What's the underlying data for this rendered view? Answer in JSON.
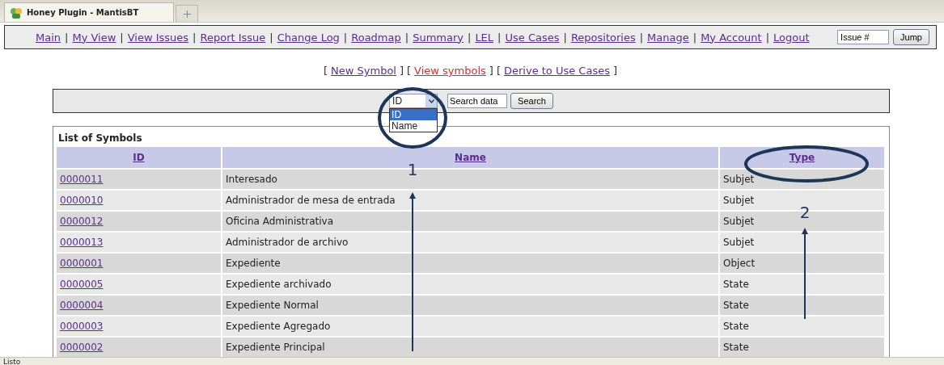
{
  "browser": {
    "tab_title": "Honey Plugin - MantisBT",
    "status": "Listo"
  },
  "nav": {
    "separator": "|",
    "links": [
      "Main",
      "My View",
      "View Issues",
      "Report Issue",
      "Change Log",
      "Roadmap",
      "Summary",
      "LEL",
      "Use Cases",
      "Repositories",
      "Manage",
      "My Account",
      "Logout"
    ],
    "issue_field": {
      "value": "Issue #"
    },
    "jump_button": "Jump"
  },
  "actions": {
    "open": "[",
    "close": "]",
    "links": [
      {
        "label": "New Symbol",
        "selected": false
      },
      {
        "label": "View symbols",
        "selected": true
      },
      {
        "label": "Derive to Use Cases",
        "selected": false
      }
    ]
  },
  "search": {
    "field_select": {
      "value": "ID",
      "options": [
        {
          "label": "ID",
          "selected": true
        },
        {
          "label": "Name",
          "selected": false
        }
      ]
    },
    "search_input": {
      "value": "Search data"
    },
    "button": "Search"
  },
  "table": {
    "title": "List of Symbols",
    "columns": [
      "ID",
      "Name",
      "Type"
    ],
    "rows": [
      {
        "id": "0000011",
        "name": "Interesado",
        "type": "Subjet"
      },
      {
        "id": "0000010",
        "name": "Administrador de mesa de entrada",
        "type": "Subjet"
      },
      {
        "id": "0000012",
        "name": "Oficina Administrativa",
        "type": "Subjet"
      },
      {
        "id": "0000013",
        "name": "Administrador de archivo",
        "type": "Subjet"
      },
      {
        "id": "0000001",
        "name": "Expediente",
        "type": "Object"
      },
      {
        "id": "0000005",
        "name": "Expediente archivado",
        "type": "State"
      },
      {
        "id": "0000004",
        "name": "Expediente Normal",
        "type": "State"
      },
      {
        "id": "0000003",
        "name": "Expediente Agregado",
        "type": "State"
      },
      {
        "id": "0000002",
        "name": "Expediente Principal",
        "type": "State"
      }
    ]
  },
  "annotations": [
    {
      "label": "1"
    },
    {
      "label": "2"
    }
  ]
}
